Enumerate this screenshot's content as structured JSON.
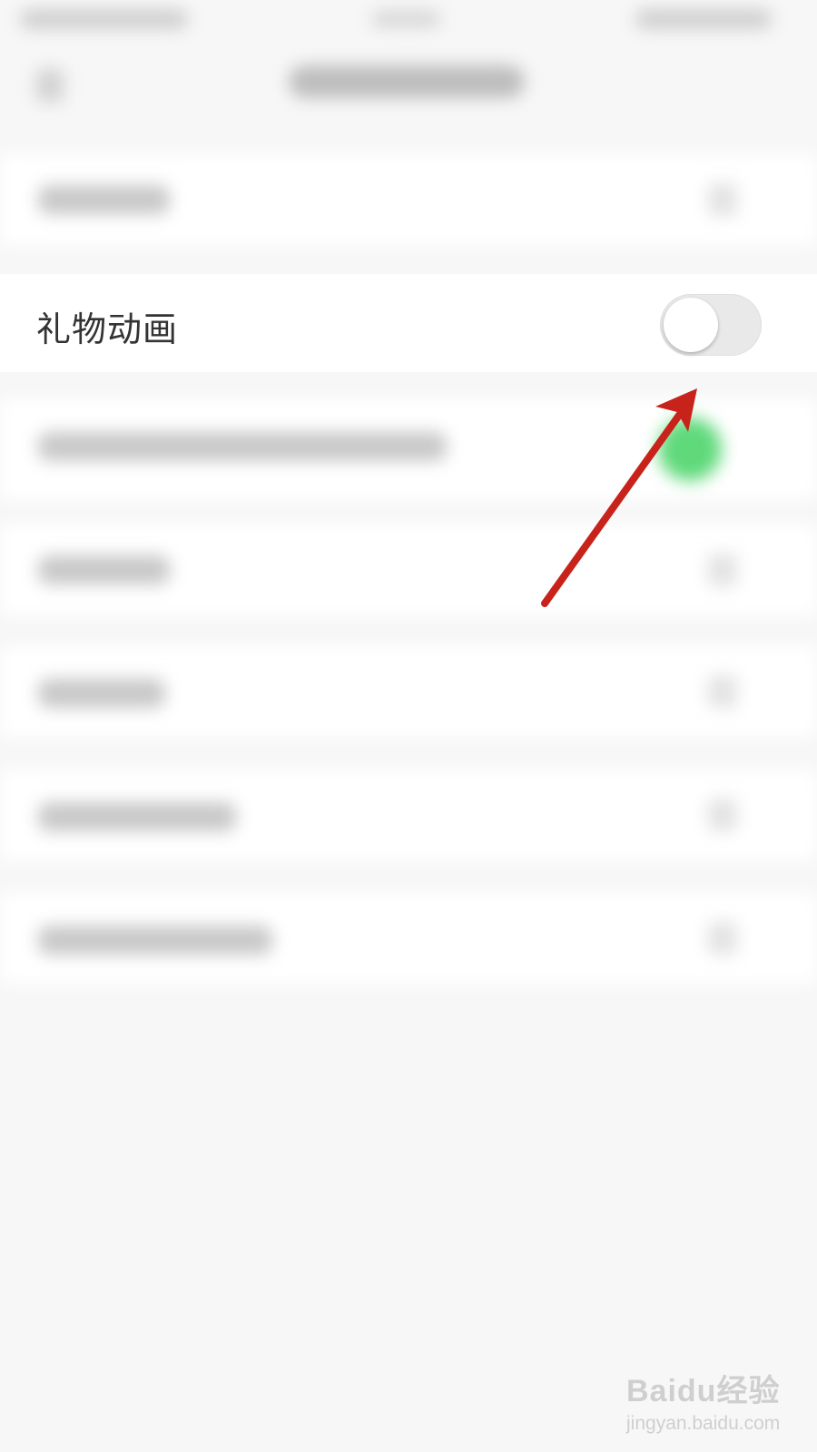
{
  "settings": {
    "gift_animation_label": "礼物动画",
    "gift_animation_enabled": false
  },
  "watermark": {
    "brand": "Baidu经验",
    "url": "jingyan.baidu.com"
  },
  "colors": {
    "background": "#f7f7f7",
    "row_background": "#ffffff",
    "toggle_off_track": "#e9e9ea",
    "annotation_arrow": "#c8231b",
    "blurred_green_toggle": "#4cd964"
  },
  "icons": {
    "annotation": "red-arrow-icon",
    "watermark": "baidu-paw-icon"
  }
}
